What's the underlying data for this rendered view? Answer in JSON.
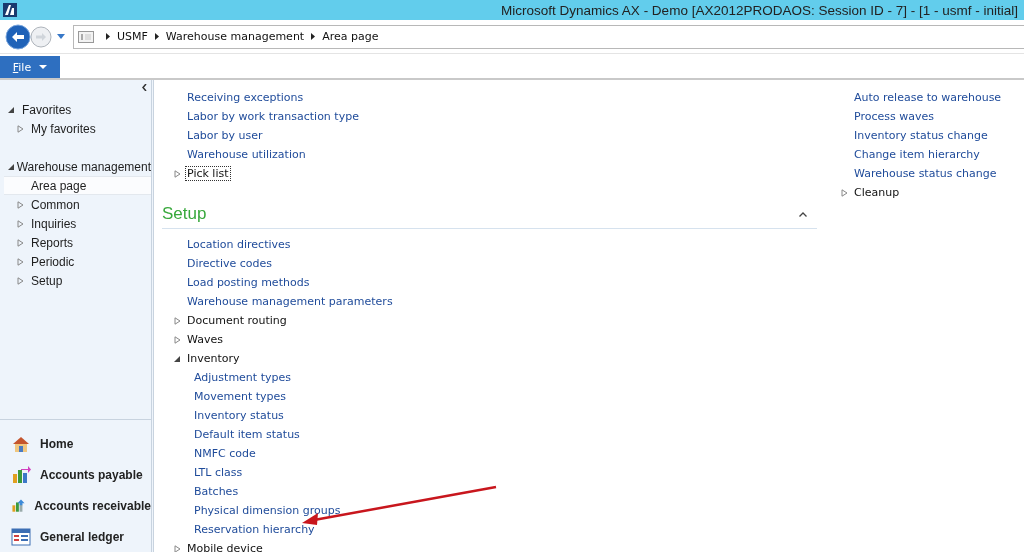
{
  "window": {
    "title": "Microsoft Dynamics AX - Demo [AX2012PRODAOS: Session ID - 7] -  [1 - usmf - initial]"
  },
  "navigation": {
    "breadcrumb": [
      "USMF",
      "Warehouse management",
      "Area page"
    ]
  },
  "ribbon": {
    "file_tab": "File"
  },
  "sidebar": {
    "tree": [
      {
        "label": "Favorites",
        "expanded": true,
        "selected": false,
        "children": [
          {
            "label": "My favorites",
            "expanded": false,
            "selected": false
          }
        ]
      },
      {
        "label": "Warehouse management",
        "expanded": true,
        "selected": false,
        "children": [
          {
            "label": "Area page",
            "selected": true
          },
          {
            "label": "Common",
            "expanded": false,
            "selected": false
          },
          {
            "label": "Inquiries",
            "expanded": false,
            "selected": false
          },
          {
            "label": "Reports",
            "expanded": false,
            "selected": false
          },
          {
            "label": "Periodic",
            "expanded": false,
            "selected": false
          },
          {
            "label": "Setup",
            "expanded": false,
            "selected": false
          }
        ]
      }
    ],
    "modules": [
      {
        "label": "Home",
        "kind": "home"
      },
      {
        "label": "Accounts payable",
        "kind": "payable"
      },
      {
        "label": "Accounts receivable",
        "kind": "receivable"
      },
      {
        "label": "General ledger",
        "kind": "ledger"
      }
    ]
  },
  "content": {
    "left": {
      "items": [
        {
          "kind": "link",
          "label": "Receiving exceptions"
        },
        {
          "kind": "link",
          "label": "Labor by work transaction type"
        },
        {
          "kind": "link",
          "label": "Labor by user"
        },
        {
          "kind": "link",
          "label": "Warehouse utilization"
        },
        {
          "kind": "group",
          "label": "Pick list",
          "expanded": false,
          "focused": true
        }
      ],
      "sections": [
        {
          "title": "Setup",
          "expanded": true,
          "items": [
            {
              "kind": "link",
              "label": "Location directives"
            },
            {
              "kind": "link",
              "label": "Directive codes"
            },
            {
              "kind": "link",
              "label": "Load posting methods"
            },
            {
              "kind": "link",
              "label": "Warehouse management parameters"
            },
            {
              "kind": "group",
              "label": "Document routing",
              "expanded": false,
              "focused": false
            },
            {
              "kind": "group",
              "label": "Waves",
              "expanded": false,
              "focused": false
            },
            {
              "kind": "group",
              "label": "Inventory",
              "expanded": true,
              "focused": false,
              "children": [
                {
                  "kind": "link",
                  "label": "Adjustment types"
                },
                {
                  "kind": "link",
                  "label": "Movement types"
                },
                {
                  "kind": "link",
                  "label": "Inventory status"
                },
                {
                  "kind": "link",
                  "label": "Default item status"
                },
                {
                  "kind": "link",
                  "label": "NMFC code"
                },
                {
                  "kind": "link",
                  "label": "LTL class"
                },
                {
                  "kind": "link",
                  "label": "Batches"
                },
                {
                  "kind": "link",
                  "label": "Physical dimension groups"
                },
                {
                  "kind": "link",
                  "label": "Reservation hierarchy"
                }
              ]
            },
            {
              "kind": "group",
              "label": "Mobile device",
              "expanded": false,
              "focused": false
            }
          ]
        }
      ]
    },
    "right": {
      "items": [
        {
          "kind": "link",
          "label": "Auto release to warehouse"
        },
        {
          "kind": "link",
          "label": "Process waves"
        },
        {
          "kind": "link",
          "label": "Inventory status change"
        },
        {
          "kind": "link",
          "label": "Change item hierarchy"
        },
        {
          "kind": "link",
          "label": "Warehouse status change"
        },
        {
          "kind": "group",
          "label": "Cleanup",
          "expanded": false,
          "focused": false
        }
      ]
    }
  }
}
